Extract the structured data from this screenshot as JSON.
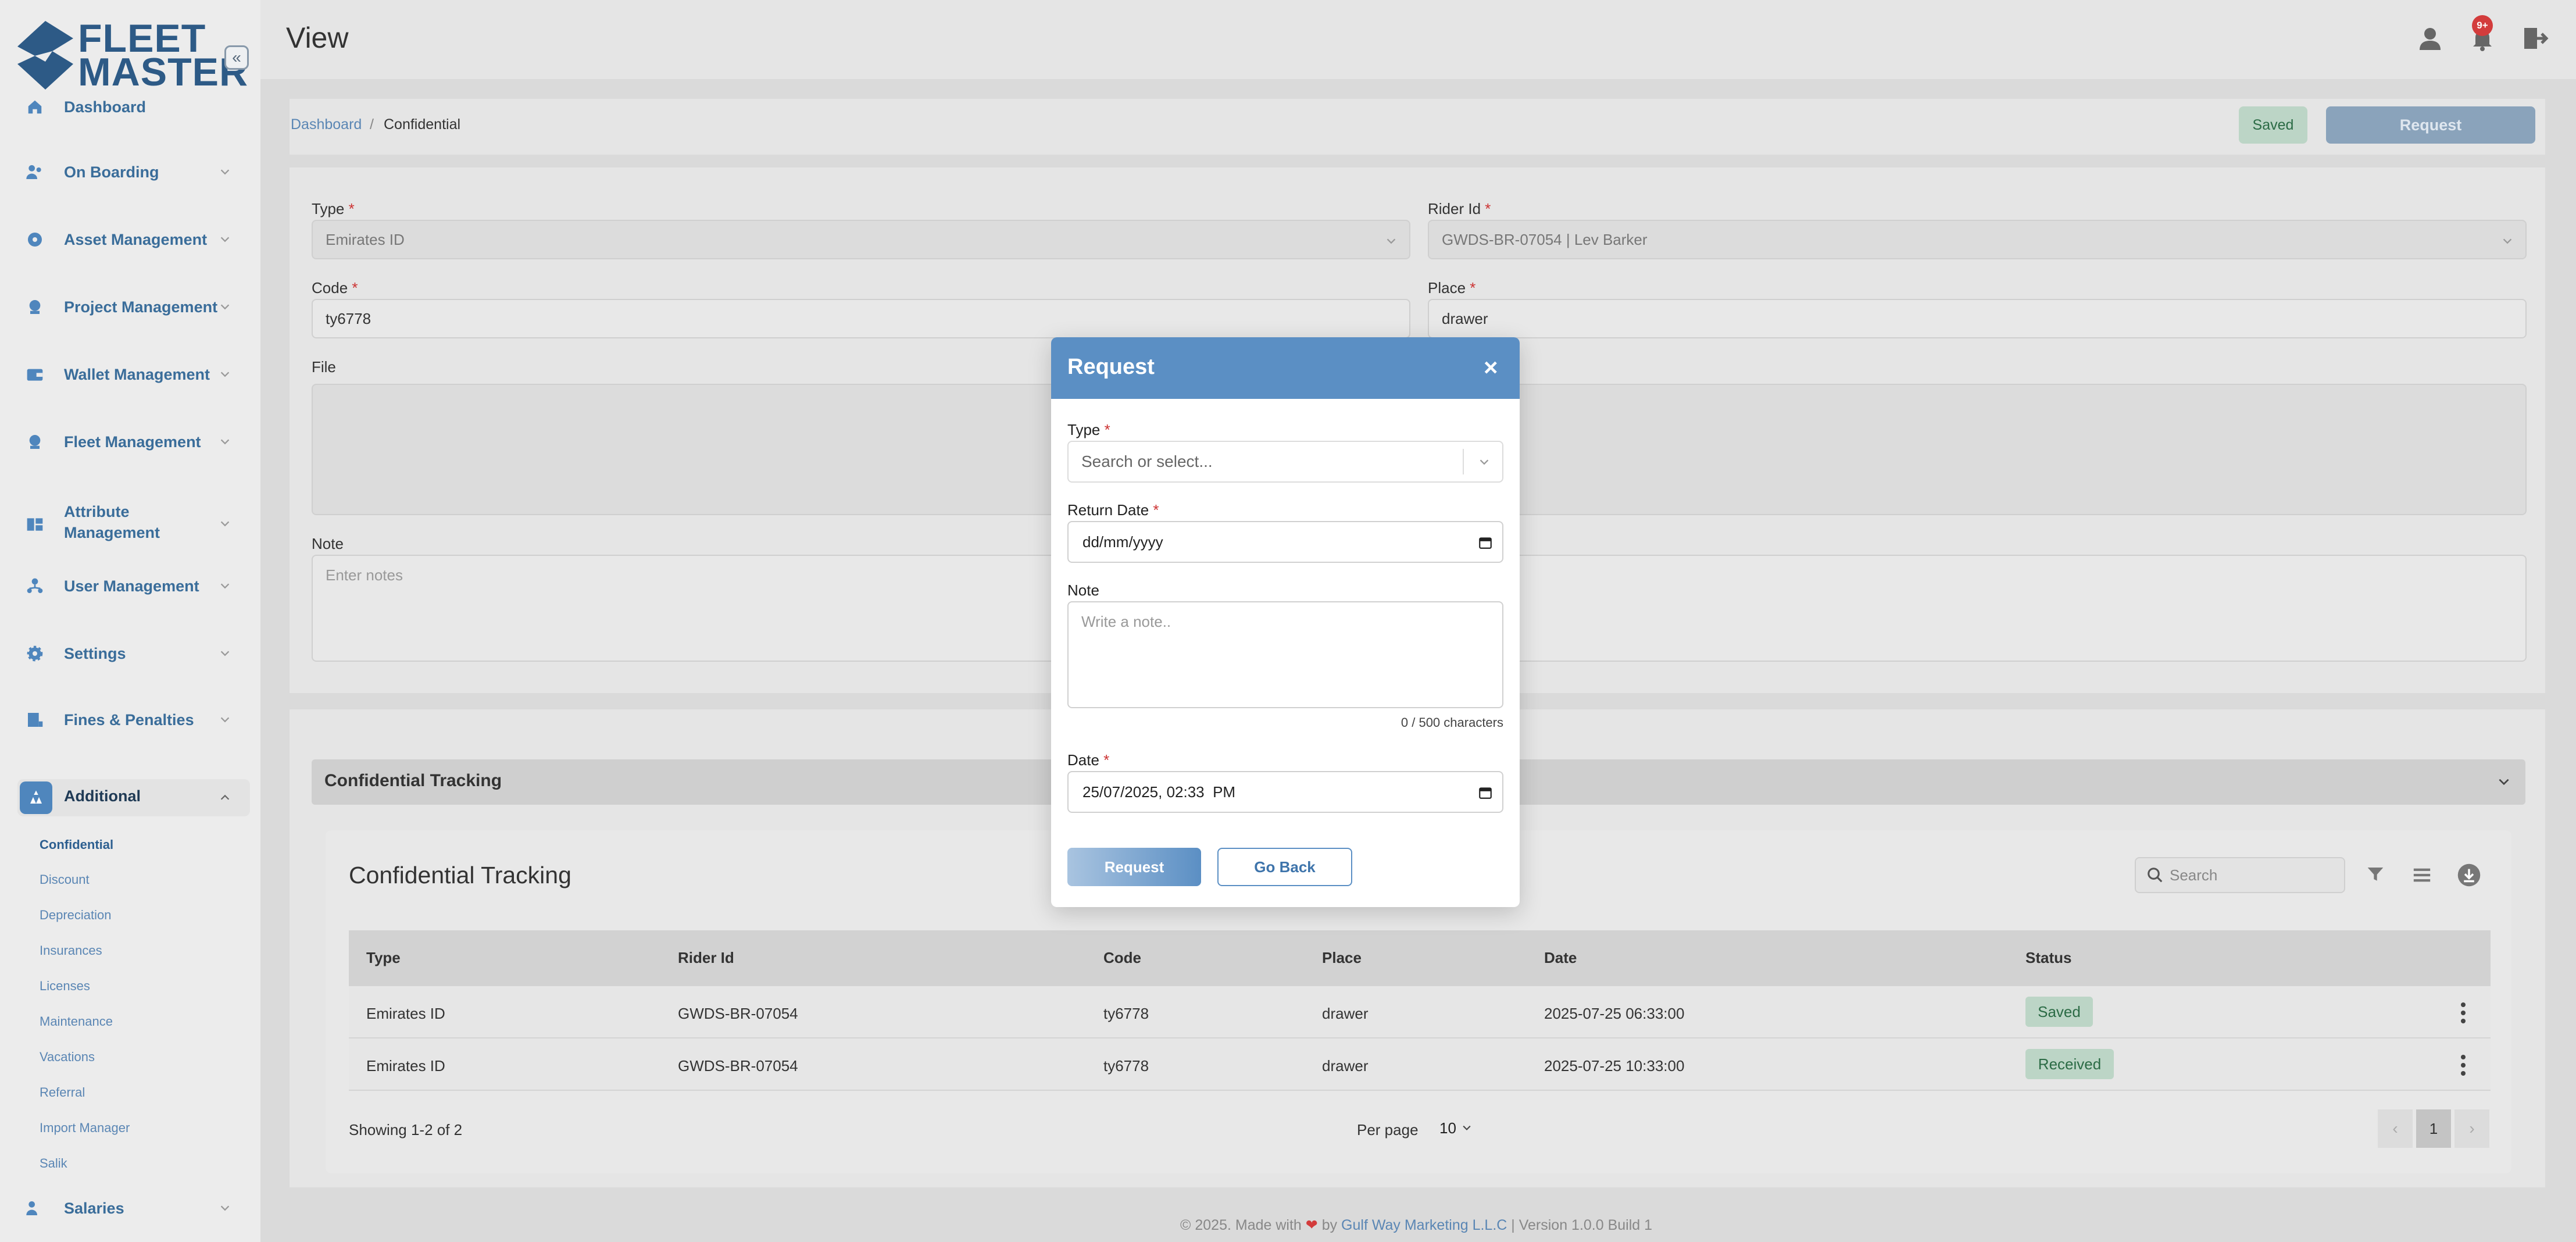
{
  "app": {
    "logo_line1": "FLEET",
    "logo_line2": "MASTER",
    "page_title": "View"
  },
  "notifications": {
    "count": "9+"
  },
  "sidebar": {
    "items": [
      {
        "label": "Dashboard"
      },
      {
        "label": "On Boarding"
      },
      {
        "label": "Asset Management"
      },
      {
        "label": "Project Management"
      },
      {
        "label": "Wallet Management"
      },
      {
        "label": "Fleet Management"
      },
      {
        "label": "Attribute Management"
      },
      {
        "label": "User Management"
      },
      {
        "label": "Settings"
      },
      {
        "label": "Fines & Penalties"
      },
      {
        "label": "Additional"
      },
      {
        "label": "Salaries"
      }
    ],
    "sub_items": [
      "Confidential",
      "Discount",
      "Depreciation",
      "Insurances",
      "Licenses",
      "Maintenance",
      "Vacations",
      "Referral",
      "Import Manager",
      "Salik"
    ]
  },
  "breadcrumb": {
    "home": "Dashboard",
    "separator": "/",
    "current": "Confidential"
  },
  "actions": {
    "saved": "Saved",
    "request": "Request"
  },
  "form": {
    "type_label": "Type",
    "type_value": "Emirates ID",
    "rider_label": "Rider Id",
    "rider_value": "GWDS-BR-07054 | Lev Barker",
    "code_label": "Code",
    "code_value": "ty6778",
    "place_label": "Place",
    "place_value": "drawer",
    "file_label": "File",
    "note_label": "Note",
    "note_placeholder": "Enter notes"
  },
  "tracking": {
    "section_title": "Confidential Tracking",
    "card_title": "Confidential Tracking",
    "search_placeholder": "Search",
    "columns": [
      "Type",
      "Rider Id",
      "Code",
      "Place",
      "Date",
      "Status"
    ],
    "rows": [
      {
        "type": "Emirates ID",
        "rider": "GWDS-BR-07054",
        "code": "ty6778",
        "place": "drawer",
        "date": "2025-07-25 06:33:00",
        "status": "Saved"
      },
      {
        "type": "Emirates ID",
        "rider": "GWDS-BR-07054",
        "code": "ty6778",
        "place": "drawer",
        "date": "2025-07-25 10:33:00",
        "status": "Received"
      }
    ],
    "showing": "Showing 1-2 of 2",
    "per_page_label": "Per page",
    "per_page_value": "10",
    "current_page": "1"
  },
  "footer": {
    "prefix": "© 2025. Made with",
    "by": "by",
    "company": "Gulf Way Marketing L.L.C",
    "suffix": "| Version 1.0.0 Build 1"
  },
  "modal": {
    "title": "Request",
    "close": "×",
    "type_label": "Type",
    "type_placeholder": "Search or select...",
    "return_label": "Return Date",
    "return_value": "dd/mm/yyyy",
    "note_label": "Note",
    "note_placeholder": "Write a note..",
    "char_count": "0 / 500 characters",
    "date_label": "Date",
    "date_value": "25/07/2025, 02:33  PM",
    "request_btn": "Request",
    "back_btn": "Go Back"
  },
  "colors": {
    "primary": "#5b8fc4",
    "saved_bg": "#bcd5c6",
    "badge": "#d33c3c"
  }
}
